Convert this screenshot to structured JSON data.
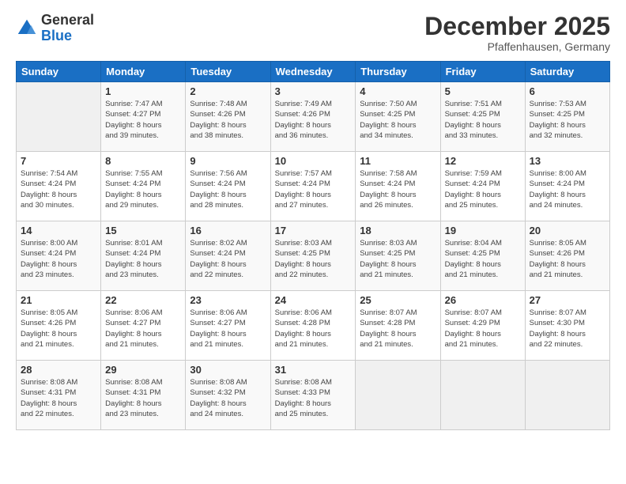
{
  "logo": {
    "line1": "General",
    "line2": "Blue"
  },
  "header": {
    "title": "December 2025",
    "subtitle": "Pfaffenhausen, Germany"
  },
  "weekdays": [
    "Sunday",
    "Monday",
    "Tuesday",
    "Wednesday",
    "Thursday",
    "Friday",
    "Saturday"
  ],
  "weeks": [
    [
      {
        "day": "",
        "info": ""
      },
      {
        "day": "1",
        "info": "Sunrise: 7:47 AM\nSunset: 4:27 PM\nDaylight: 8 hours\nand 39 minutes."
      },
      {
        "day": "2",
        "info": "Sunrise: 7:48 AM\nSunset: 4:26 PM\nDaylight: 8 hours\nand 38 minutes."
      },
      {
        "day": "3",
        "info": "Sunrise: 7:49 AM\nSunset: 4:26 PM\nDaylight: 8 hours\nand 36 minutes."
      },
      {
        "day": "4",
        "info": "Sunrise: 7:50 AM\nSunset: 4:25 PM\nDaylight: 8 hours\nand 34 minutes."
      },
      {
        "day": "5",
        "info": "Sunrise: 7:51 AM\nSunset: 4:25 PM\nDaylight: 8 hours\nand 33 minutes."
      },
      {
        "day": "6",
        "info": "Sunrise: 7:53 AM\nSunset: 4:25 PM\nDaylight: 8 hours\nand 32 minutes."
      }
    ],
    [
      {
        "day": "7",
        "info": "Sunrise: 7:54 AM\nSunset: 4:24 PM\nDaylight: 8 hours\nand 30 minutes."
      },
      {
        "day": "8",
        "info": "Sunrise: 7:55 AM\nSunset: 4:24 PM\nDaylight: 8 hours\nand 29 minutes."
      },
      {
        "day": "9",
        "info": "Sunrise: 7:56 AM\nSunset: 4:24 PM\nDaylight: 8 hours\nand 28 minutes."
      },
      {
        "day": "10",
        "info": "Sunrise: 7:57 AM\nSunset: 4:24 PM\nDaylight: 8 hours\nand 27 minutes."
      },
      {
        "day": "11",
        "info": "Sunrise: 7:58 AM\nSunset: 4:24 PM\nDaylight: 8 hours\nand 26 minutes."
      },
      {
        "day": "12",
        "info": "Sunrise: 7:59 AM\nSunset: 4:24 PM\nDaylight: 8 hours\nand 25 minutes."
      },
      {
        "day": "13",
        "info": "Sunrise: 8:00 AM\nSunset: 4:24 PM\nDaylight: 8 hours\nand 24 minutes."
      }
    ],
    [
      {
        "day": "14",
        "info": "Sunrise: 8:00 AM\nSunset: 4:24 PM\nDaylight: 8 hours\nand 23 minutes."
      },
      {
        "day": "15",
        "info": "Sunrise: 8:01 AM\nSunset: 4:24 PM\nDaylight: 8 hours\nand 23 minutes."
      },
      {
        "day": "16",
        "info": "Sunrise: 8:02 AM\nSunset: 4:24 PM\nDaylight: 8 hours\nand 22 minutes."
      },
      {
        "day": "17",
        "info": "Sunrise: 8:03 AM\nSunset: 4:25 PM\nDaylight: 8 hours\nand 22 minutes."
      },
      {
        "day": "18",
        "info": "Sunrise: 8:03 AM\nSunset: 4:25 PM\nDaylight: 8 hours\nand 21 minutes."
      },
      {
        "day": "19",
        "info": "Sunrise: 8:04 AM\nSunset: 4:25 PM\nDaylight: 8 hours\nand 21 minutes."
      },
      {
        "day": "20",
        "info": "Sunrise: 8:05 AM\nSunset: 4:26 PM\nDaylight: 8 hours\nand 21 minutes."
      }
    ],
    [
      {
        "day": "21",
        "info": "Sunrise: 8:05 AM\nSunset: 4:26 PM\nDaylight: 8 hours\nand 21 minutes."
      },
      {
        "day": "22",
        "info": "Sunrise: 8:06 AM\nSunset: 4:27 PM\nDaylight: 8 hours\nand 21 minutes."
      },
      {
        "day": "23",
        "info": "Sunrise: 8:06 AM\nSunset: 4:27 PM\nDaylight: 8 hours\nand 21 minutes."
      },
      {
        "day": "24",
        "info": "Sunrise: 8:06 AM\nSunset: 4:28 PM\nDaylight: 8 hours\nand 21 minutes."
      },
      {
        "day": "25",
        "info": "Sunrise: 8:07 AM\nSunset: 4:28 PM\nDaylight: 8 hours\nand 21 minutes."
      },
      {
        "day": "26",
        "info": "Sunrise: 8:07 AM\nSunset: 4:29 PM\nDaylight: 8 hours\nand 21 minutes."
      },
      {
        "day": "27",
        "info": "Sunrise: 8:07 AM\nSunset: 4:30 PM\nDaylight: 8 hours\nand 22 minutes."
      }
    ],
    [
      {
        "day": "28",
        "info": "Sunrise: 8:08 AM\nSunset: 4:31 PM\nDaylight: 8 hours\nand 22 minutes."
      },
      {
        "day": "29",
        "info": "Sunrise: 8:08 AM\nSunset: 4:31 PM\nDaylight: 8 hours\nand 23 minutes."
      },
      {
        "day": "30",
        "info": "Sunrise: 8:08 AM\nSunset: 4:32 PM\nDaylight: 8 hours\nand 24 minutes."
      },
      {
        "day": "31",
        "info": "Sunrise: 8:08 AM\nSunset: 4:33 PM\nDaylight: 8 hours\nand 25 minutes."
      },
      {
        "day": "",
        "info": ""
      },
      {
        "day": "",
        "info": ""
      },
      {
        "day": "",
        "info": ""
      }
    ]
  ]
}
